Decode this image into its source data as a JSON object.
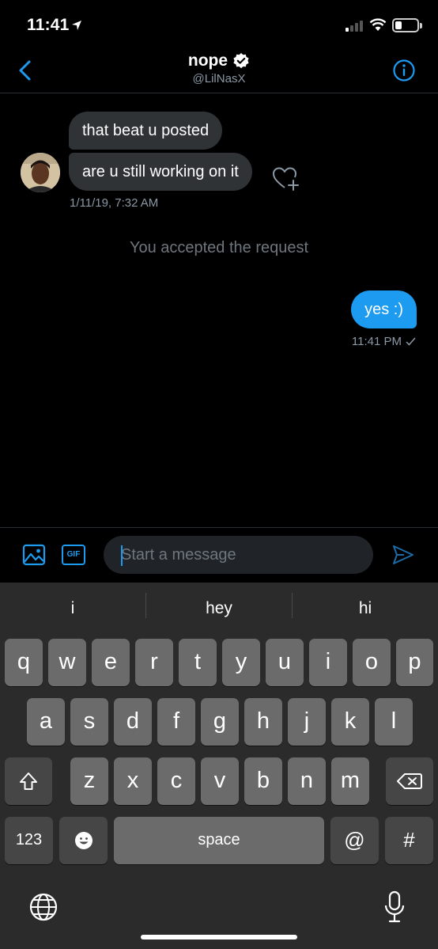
{
  "status_bar": {
    "time": "11:41"
  },
  "header": {
    "name": "nope",
    "handle": "@LilNasX"
  },
  "messages": {
    "incoming": [
      {
        "text": "that beat u posted"
      },
      {
        "text": "are u still working on it"
      }
    ],
    "incoming_timestamp": "1/11/19, 7:32 AM",
    "system": "You accepted the request",
    "outgoing": [
      {
        "text": "yes :)"
      }
    ],
    "outgoing_timestamp": "11:41 PM"
  },
  "composer": {
    "gif_label": "GIF",
    "placeholder": "Start a message"
  },
  "keyboard": {
    "suggestions": [
      "i",
      "hey",
      "hi"
    ],
    "row1": [
      "q",
      "w",
      "e",
      "r",
      "t",
      "y",
      "u",
      "i",
      "o",
      "p"
    ],
    "row2": [
      "a",
      "s",
      "d",
      "f",
      "g",
      "h",
      "j",
      "k",
      "l"
    ],
    "row3": [
      "z",
      "x",
      "c",
      "v",
      "b",
      "n",
      "m"
    ],
    "numbers_label": "123",
    "space_label": "space",
    "at_label": "@",
    "hash_label": "#"
  },
  "colors": {
    "accent": "#1d9bf0",
    "bubble_in": "#2f3336",
    "keyboard_bg": "#2b2b2b"
  },
  "icons": [
    "back-chevron-icon",
    "verified-badge-icon",
    "info-icon",
    "like-heart-icon",
    "image-icon",
    "gif-icon",
    "send-icon",
    "shift-icon",
    "backspace-icon",
    "emoji-icon",
    "globe-icon",
    "microphone-icon"
  ]
}
